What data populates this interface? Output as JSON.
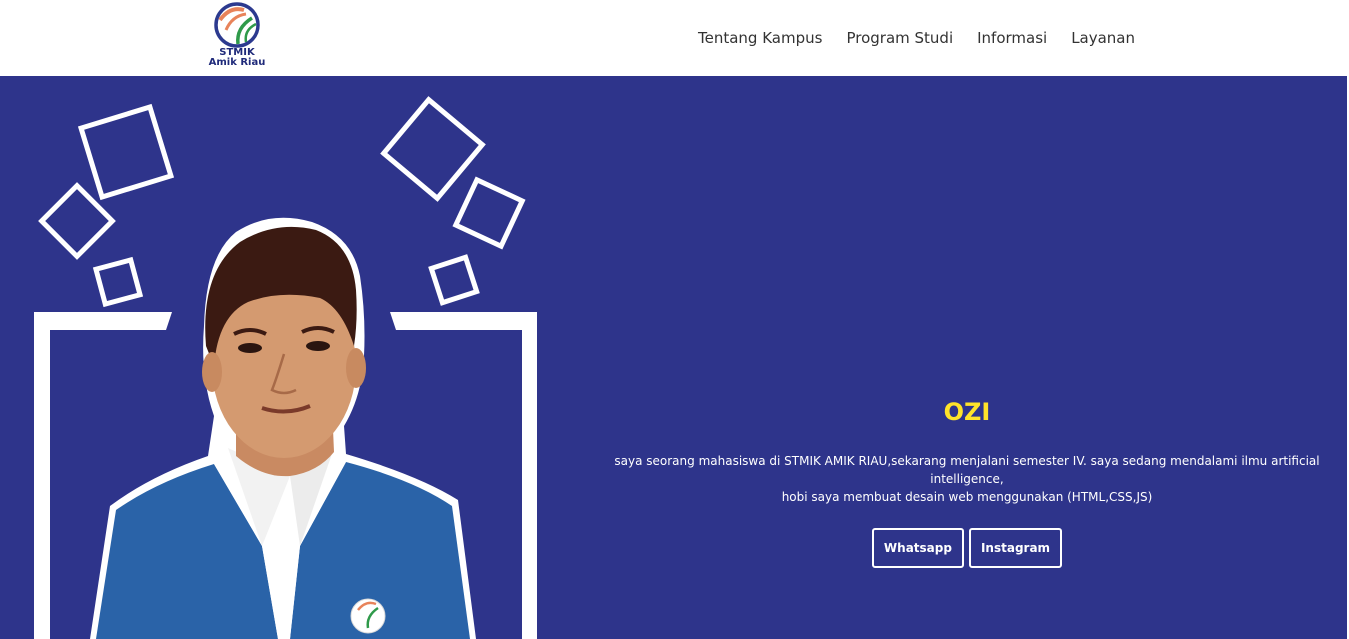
{
  "navbar": {
    "logo": {
      "line1": "STMIK",
      "line2": "Amik Riau",
      "icon": "stmik-amik-riau-logo"
    },
    "links": [
      {
        "label": "Tentang Kampus"
      },
      {
        "label": "Program Studi"
      },
      {
        "label": "Informasi"
      },
      {
        "label": "Layanan"
      }
    ]
  },
  "hero": {
    "background_color": "#2e348b",
    "name": "OZI",
    "name_color": "#ffe32a",
    "bio_line1": "saya seorang mahasiswa di STMIK AMIK RIAU,sekarang menjalani semester IV. saya sedang mendalami ilmu artificial intelligence,",
    "bio_line2": "hobi saya membuat desain web menggunakan (HTML,CSS,JS)",
    "buttons": [
      {
        "label": "Whatsapp"
      },
      {
        "label": "Instagram"
      }
    ],
    "photo": "student-portrait"
  }
}
